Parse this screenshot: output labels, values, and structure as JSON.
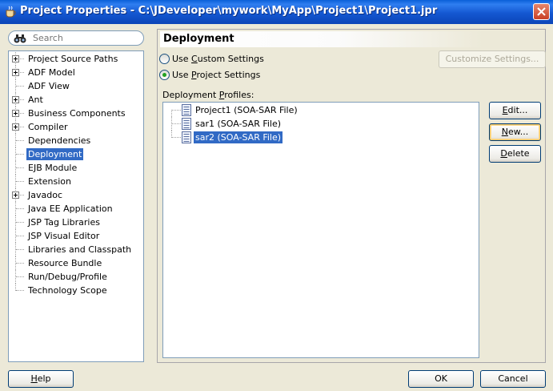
{
  "window": {
    "title": "Project Properties - C:\\JDeveloper\\mywork\\MyApp\\Project1\\Project1.jpr"
  },
  "search": {
    "placeholder": "Search"
  },
  "nav_tree": {
    "items": [
      {
        "label": "Project Source Paths",
        "expandable": true
      },
      {
        "label": "ADF Model",
        "expandable": true
      },
      {
        "label": "ADF View",
        "expandable": false
      },
      {
        "label": "Ant",
        "expandable": true
      },
      {
        "label": "Business Components",
        "expandable": true
      },
      {
        "label": "Compiler",
        "expandable": true
      },
      {
        "label": "Dependencies",
        "expandable": false
      },
      {
        "label": "Deployment",
        "expandable": false,
        "selected": true
      },
      {
        "label": "EJB Module",
        "expandable": false
      },
      {
        "label": "Extension",
        "expandable": false
      },
      {
        "label": "Javadoc",
        "expandable": true
      },
      {
        "label": "Java EE Application",
        "expandable": false
      },
      {
        "label": "JSP Tag Libraries",
        "expandable": false
      },
      {
        "label": "JSP Visual Editor",
        "expandable": false
      },
      {
        "label": "Libraries and Classpath",
        "expandable": false
      },
      {
        "label": "Resource Bundle",
        "expandable": false
      },
      {
        "label": "Run/Debug/Profile",
        "expandable": false
      },
      {
        "label": "Technology Scope",
        "expandable": false
      }
    ]
  },
  "panel": {
    "title": "Deployment",
    "radio_custom": {
      "pre": "Use ",
      "mnemonic": "C",
      "post": "ustom Settings",
      "checked": false
    },
    "radio_project": {
      "pre": "Use ",
      "mnemonic": "P",
      "post": "roject Settings",
      "checked": true
    },
    "customize_button": "Customize Settings...",
    "profiles_label": {
      "pre": "Deployment ",
      "mnemonic": "P",
      "post": "rofiles:"
    },
    "profiles": [
      {
        "label": "Project1 (SOA-SAR File)",
        "selected": false
      },
      {
        "label": "sar1 (SOA-SAR File)",
        "selected": false
      },
      {
        "label": "sar2 (SOA-SAR File)",
        "selected": true
      }
    ],
    "edit_button": {
      "mnemonic": "E",
      "rest": "dit..."
    },
    "new_button": {
      "mnemonic": "N",
      "rest": "ew..."
    },
    "delete_button": {
      "mnemonic": "D",
      "rest": "elete"
    }
  },
  "footer": {
    "help_button": {
      "mnemonic": "H",
      "rest": "elp"
    },
    "ok_button": "OK",
    "cancel_button": "Cancel"
  },
  "colors": {
    "titlebar": "#0b4fcf",
    "selection": "#316ac5",
    "dialog_bg": "#ece9d8"
  }
}
